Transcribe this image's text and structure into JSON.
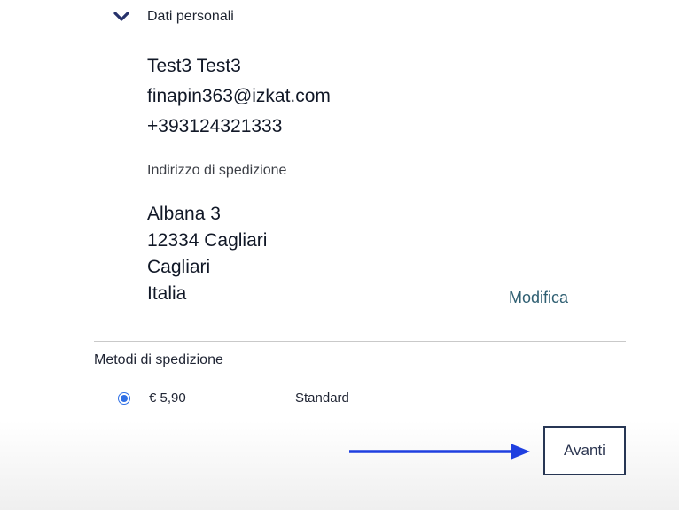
{
  "personal_data": {
    "section_title": "Dati personali",
    "name": "Test3 Test3",
    "email": "finapin363@izkat.com",
    "phone": "+393124321333"
  },
  "shipping_address": {
    "label": "Indirizzo di spedizione",
    "street": "Albana 3",
    "postal_city": "12334 Cagliari",
    "province": "Cagliari",
    "country": "Italia",
    "edit_label": "Modifica"
  },
  "shipping_methods": {
    "title": "Metodi di spedizione",
    "options": [
      {
        "price": "€ 5,90",
        "name": "Standard",
        "selected": true
      }
    ]
  },
  "actions": {
    "next_label": "Avanti"
  },
  "colors": {
    "text_dark": "#111827",
    "chevron": "#27326b",
    "link": "#2f5f72",
    "radio_selected": "#2f6fe5",
    "button_border": "#273654",
    "annotation_arrow": "#1f3fe0",
    "divider": "#c9c9c9"
  }
}
